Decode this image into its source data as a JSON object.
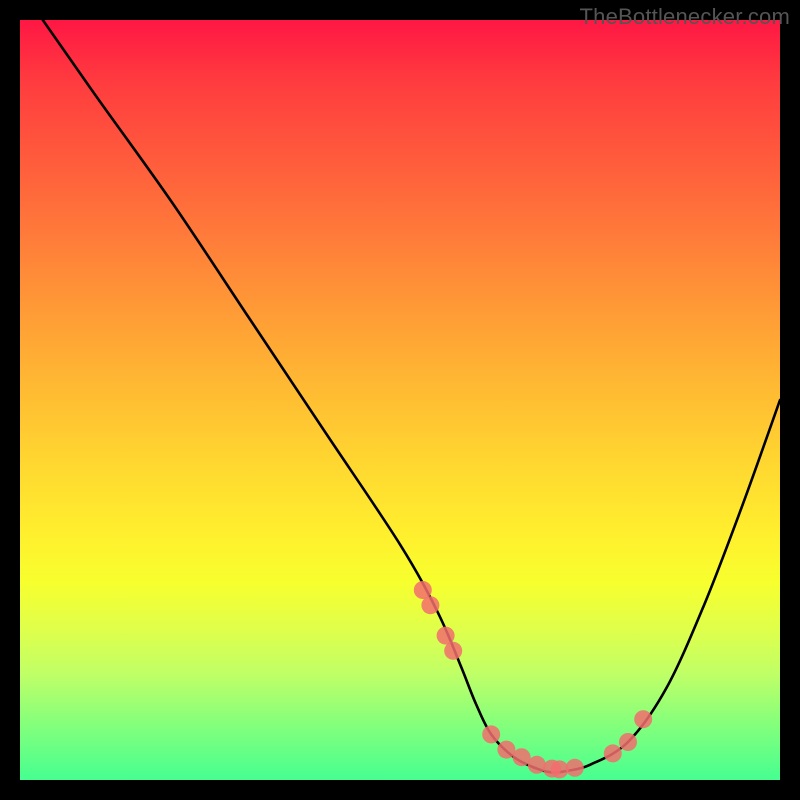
{
  "watermark_text": "TheBottlenecker.com",
  "chart_data": {
    "type": "line",
    "title": "",
    "xlabel": "",
    "ylabel": "",
    "xlim": [
      0,
      100
    ],
    "ylim": [
      0,
      100
    ],
    "curve": {
      "name": "bottleneck-curve",
      "x": [
        3,
        10,
        20,
        30,
        40,
        50,
        55,
        58,
        60,
        62,
        65,
        68,
        70,
        72,
        75,
        80,
        85,
        90,
        95,
        100
      ],
      "y": [
        100,
        90,
        76,
        61,
        46,
        31,
        22,
        15,
        10,
        6,
        3,
        1.5,
        1,
        1.2,
        2,
        5,
        12,
        23,
        36,
        50
      ]
    },
    "markers": {
      "name": "highlight-points",
      "x": [
        53,
        54,
        56,
        57,
        62,
        64,
        66,
        68,
        70,
        71,
        73,
        78,
        80,
        82
      ],
      "y": [
        25,
        23,
        19,
        17,
        6,
        4,
        3,
        2,
        1.5,
        1.4,
        1.6,
        3.5,
        5,
        8
      ]
    }
  }
}
